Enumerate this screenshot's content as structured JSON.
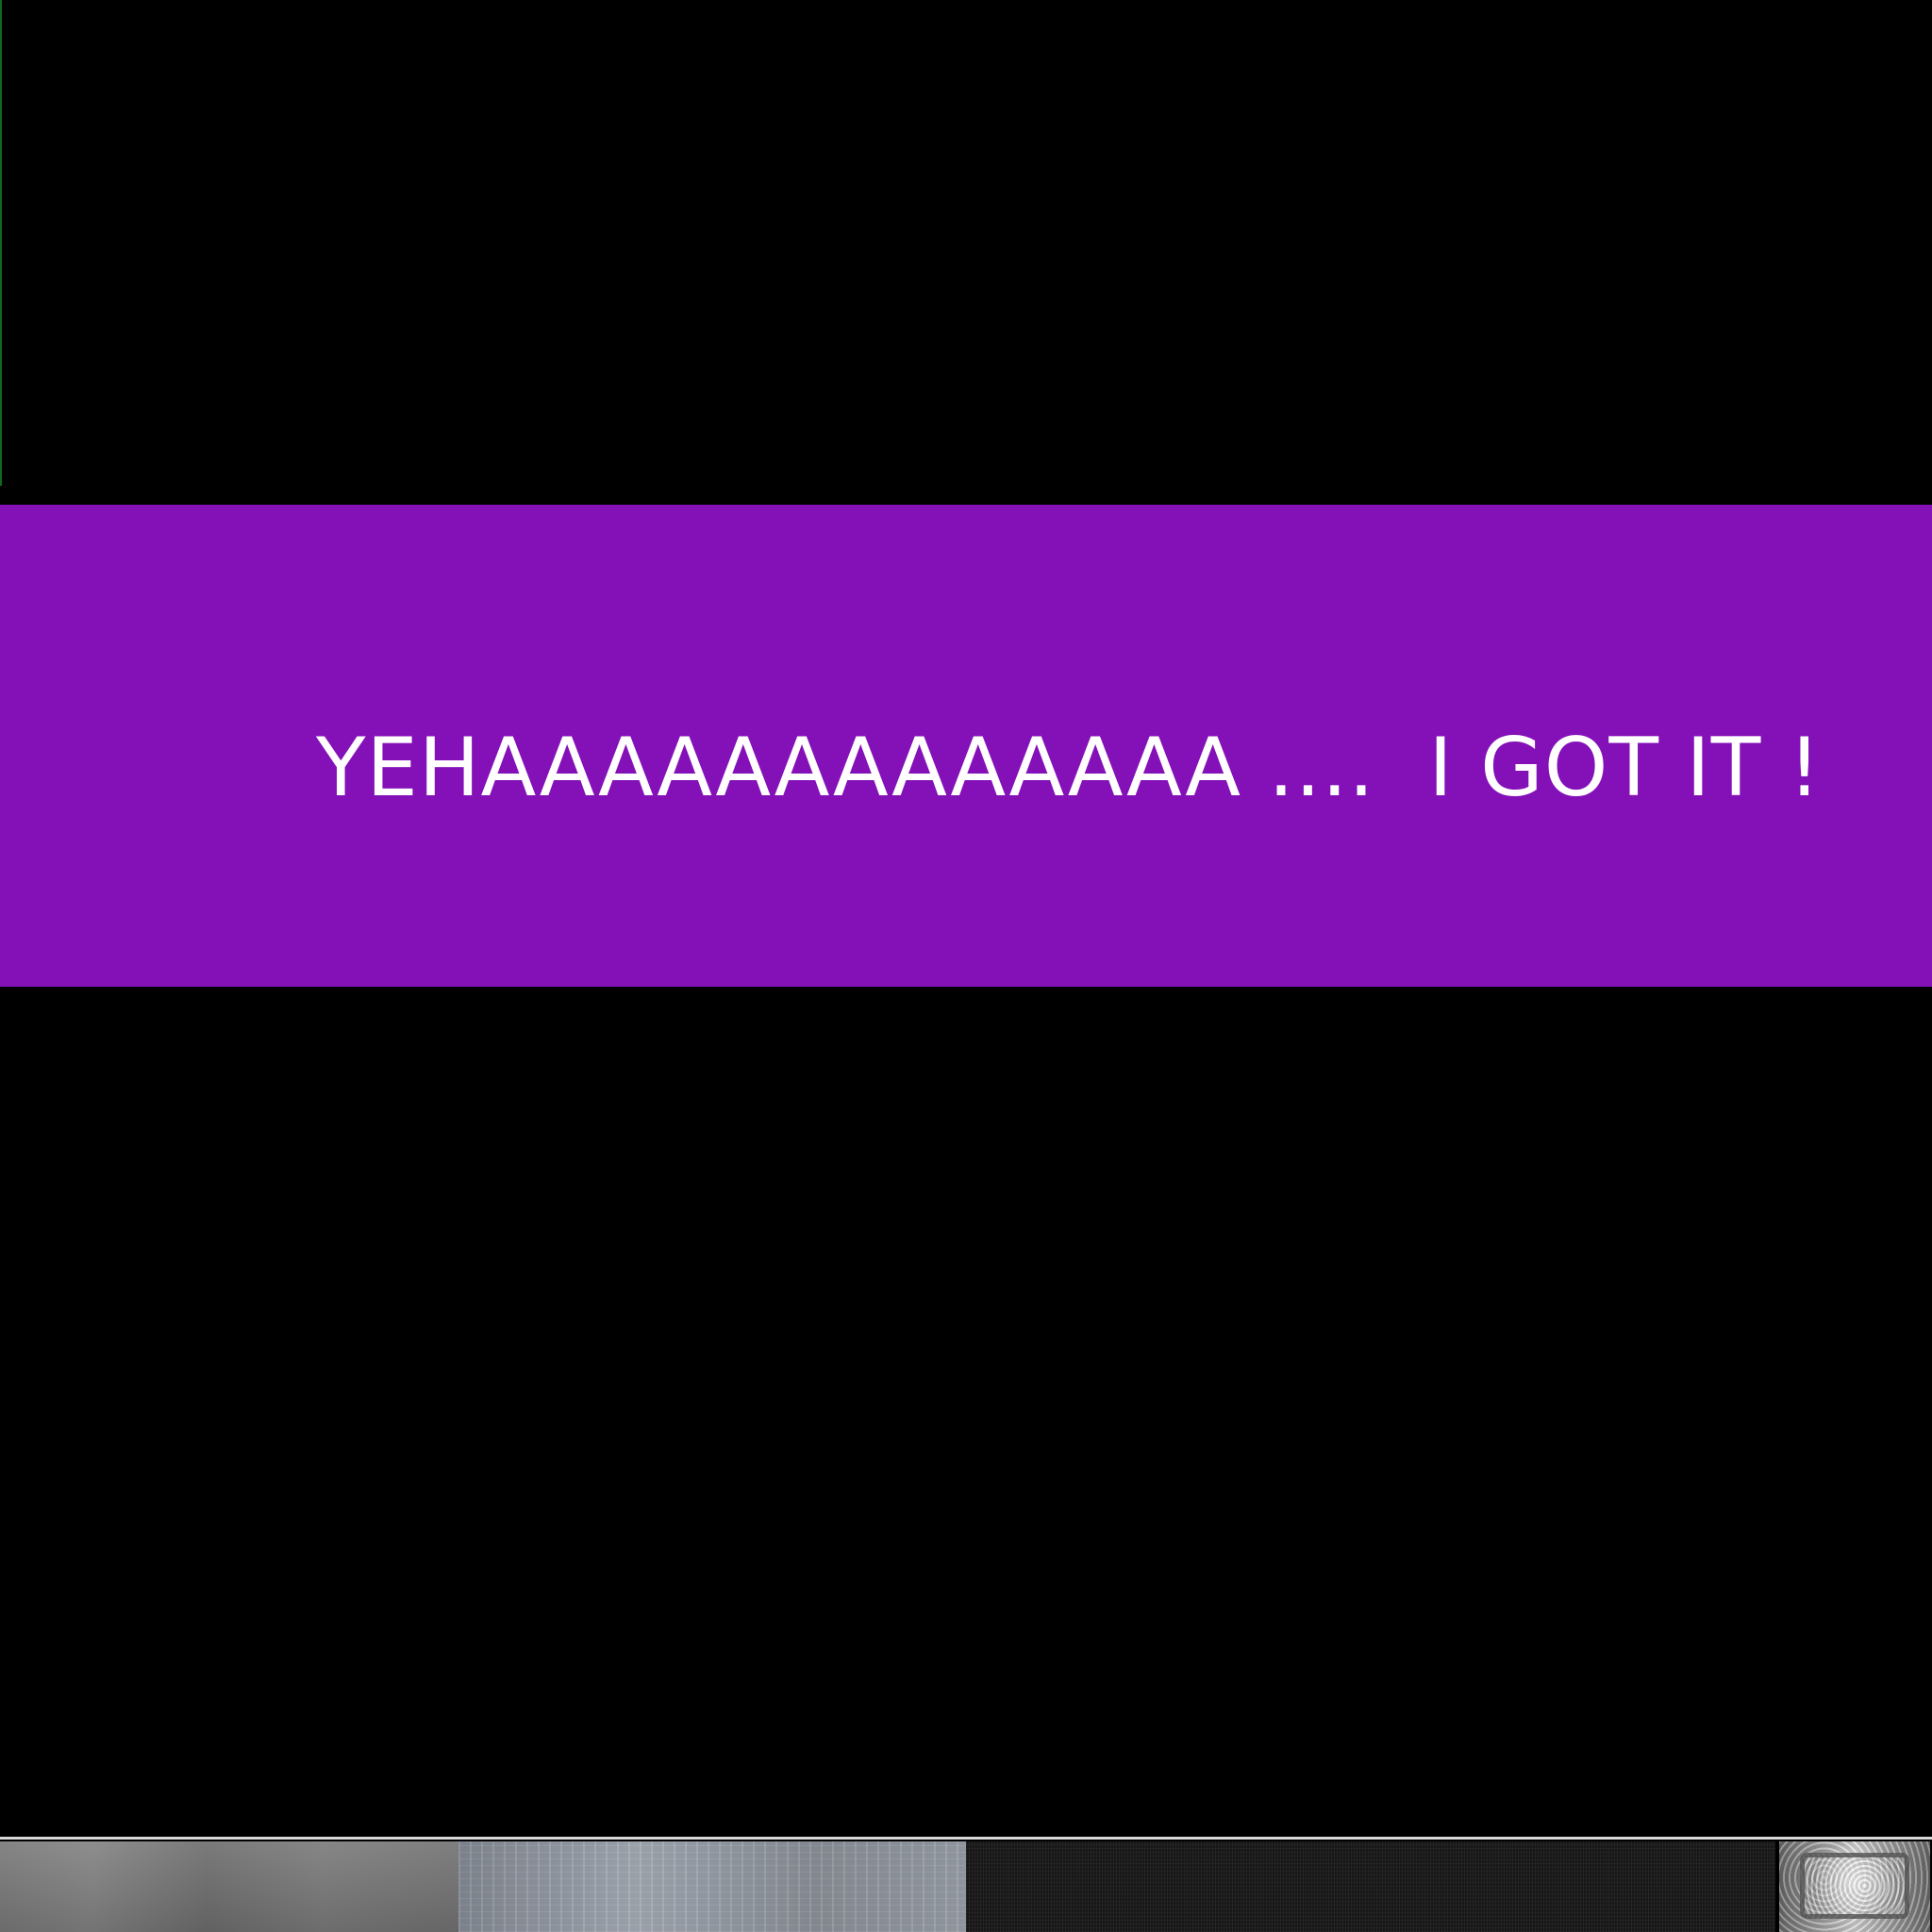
{
  "screen": {
    "background_color": "#000000",
    "accent_color": "#8410B8",
    "text_color": "#FFFFFF"
  },
  "banner": {
    "message": "YEHAAAAAAAAAAAAA ....  I GOT IT !"
  },
  "bottom_strip": {
    "separator_color": "#D8D8D8",
    "textures": [
      "gray-metal-texture",
      "brushed-metal-texture",
      "dark-fabric-texture",
      "hammered-metal-icon"
    ]
  }
}
